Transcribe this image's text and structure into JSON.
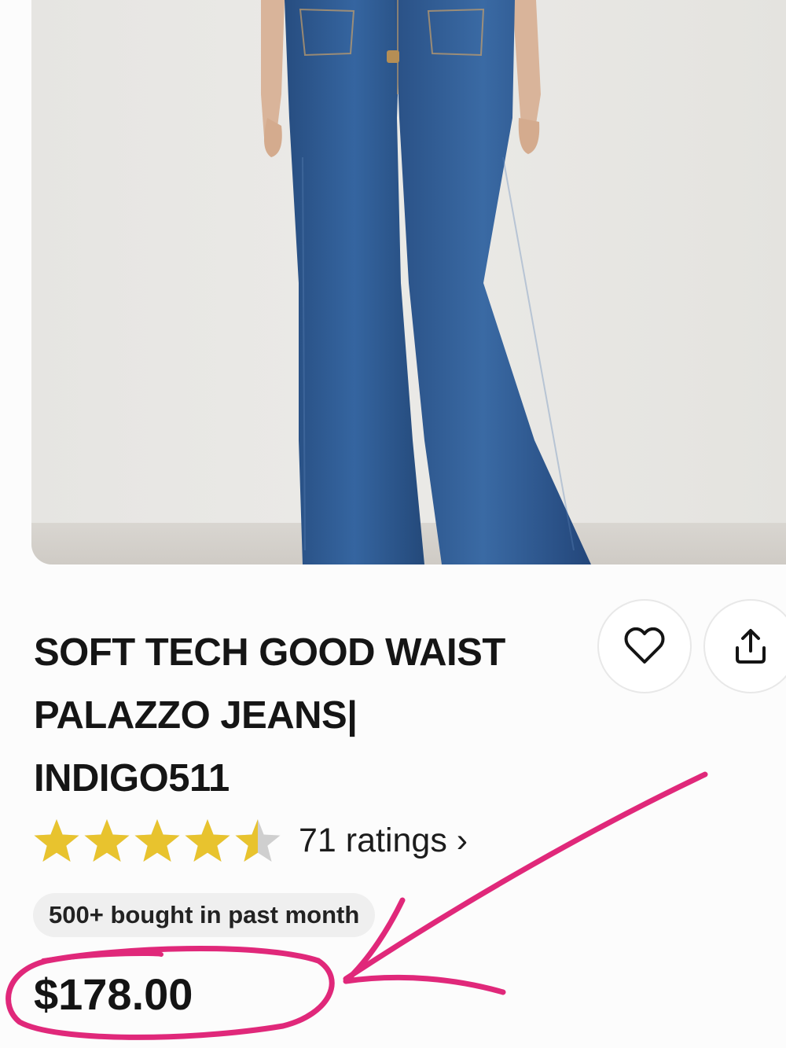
{
  "product": {
    "title_lines": [
      "SOFT TECH GOOD WAIST",
      "PALAZZO JEANS|",
      "INDIGO511"
    ],
    "rating": 4.5,
    "max_rating": 5,
    "ratings_text": "71 ratings ›",
    "bought_badge": "500+ bought in past month",
    "price": "$178.00",
    "image_icon": "wide-leg-jeans-photo"
  },
  "actions": {
    "favorite_icon": "heart-icon",
    "share_icon": "share-icon"
  },
  "colors": {
    "star_filled": "#e8c32e",
    "star_empty": "#cfcfcf",
    "annotation": "#e0287a",
    "denim": "#2e5990"
  }
}
